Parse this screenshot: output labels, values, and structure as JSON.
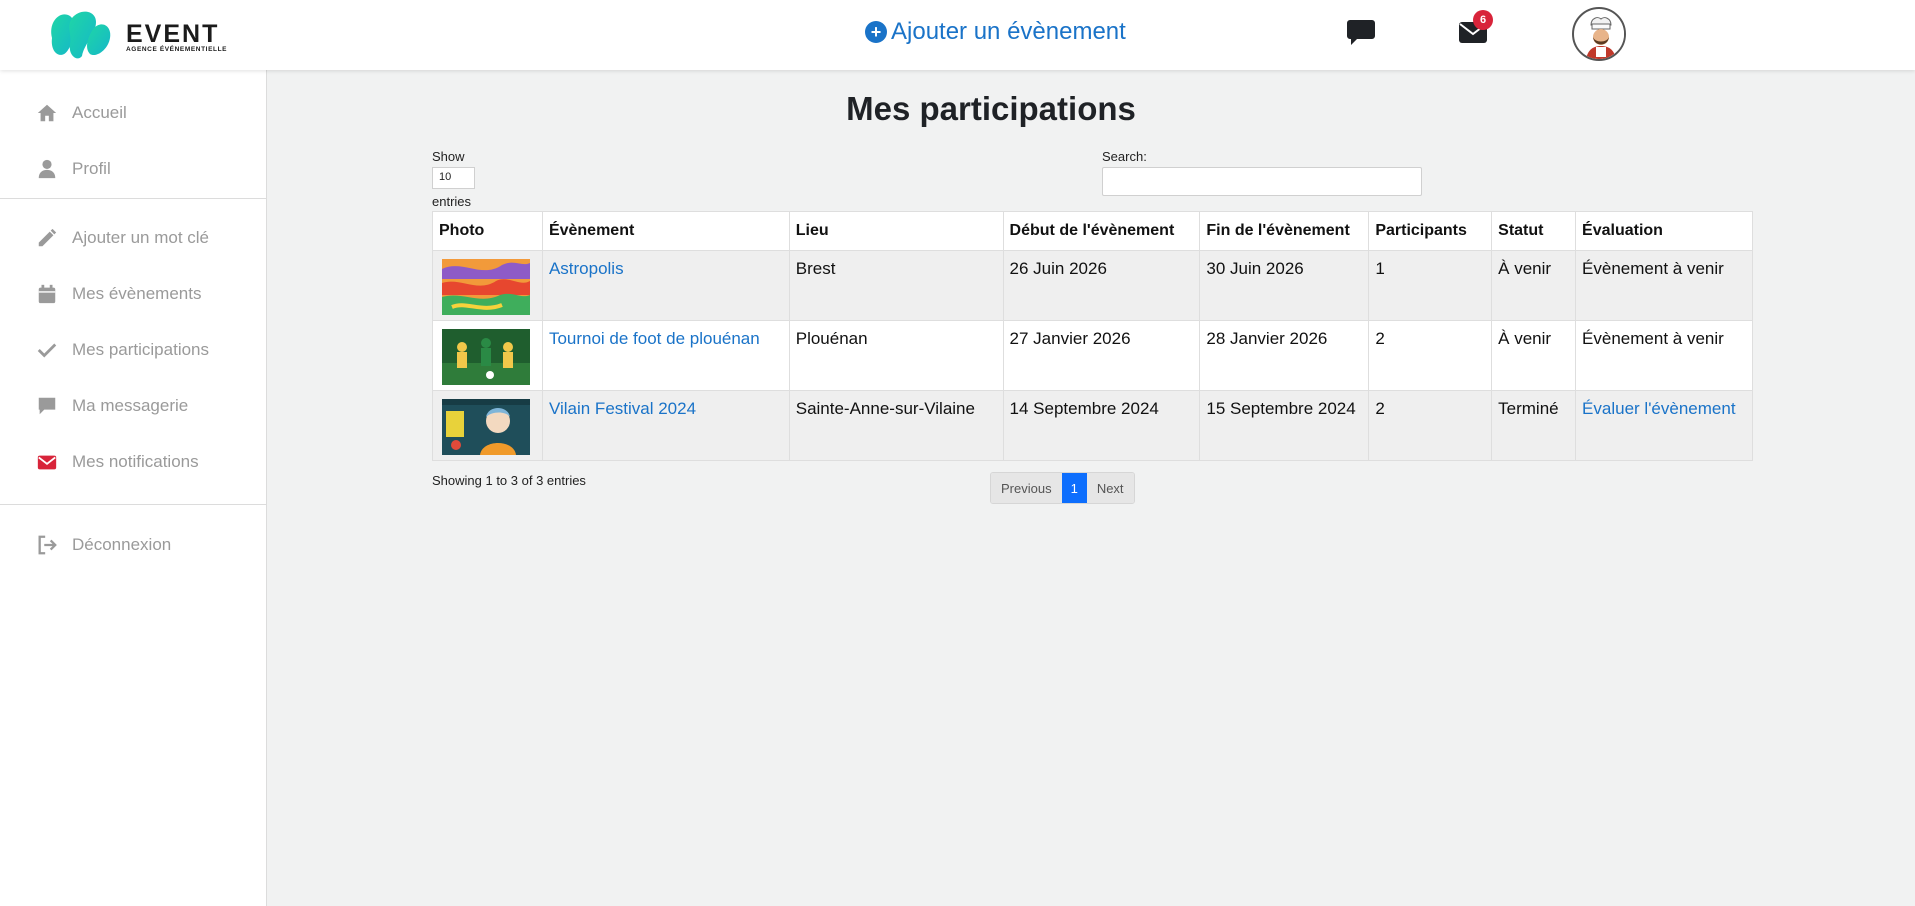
{
  "header": {
    "logo_title": "EVENT",
    "logo_subtitle": "AGENCE ÉVÉNEMENTIELLE",
    "add_event_label": "Ajouter un évènement",
    "mail_badge_count": "6",
    "accent_color": "#1a73c8",
    "badge_color": "#d8243a"
  },
  "sidebar": {
    "items": [
      {
        "label": "Accueil",
        "icon": "home-icon"
      },
      {
        "label": "Profil",
        "icon": "user-icon"
      },
      {
        "label": "Ajouter un mot clé",
        "icon": "pencil-icon"
      },
      {
        "label": "Mes évènements",
        "icon": "calendar-icon"
      },
      {
        "label": "Mes participations",
        "icon": "check-icon"
      },
      {
        "label": "Ma messagerie",
        "icon": "chat-icon"
      },
      {
        "label": "Mes notifications",
        "icon": "envelope-icon"
      },
      {
        "label": "Déconnexion",
        "icon": "logout-icon"
      }
    ]
  },
  "main": {
    "title": "Mes participations",
    "length": {
      "show_label": "Show",
      "value": "10",
      "entries_label": "entries"
    },
    "search": {
      "label": "Search:",
      "value": ""
    },
    "table": {
      "columns": [
        "Photo",
        "Évènement",
        "Lieu",
        "Début de l'évènement",
        "Fin de l'évènement",
        "Participants",
        "Statut",
        "Évaluation"
      ],
      "rows": [
        {
          "event": "Astropolis",
          "lieu": "Brest",
          "debut": "26 Juin 2026",
          "fin": "30 Juin 2026",
          "participants": "1",
          "statut": "À venir",
          "evaluation": "Évènement à venir"
        },
        {
          "event": "Tournoi de foot de plouénan",
          "lieu": "Plouénan",
          "debut": "27 Janvier 2026",
          "fin": "28 Janvier 2026",
          "participants": "2",
          "statut": "À venir",
          "evaluation": "Évènement à venir"
        },
        {
          "event": "Vilain Festival 2024",
          "lieu": "Sainte-Anne-sur-Vilaine",
          "debut": "14 Septembre 2024",
          "fin": "15 Septembre 2024",
          "participants": "2",
          "statut": "Terminé",
          "evaluation": "Évaluer l'évènement"
        }
      ]
    },
    "info": "Showing 1 to 3 of 3 entries",
    "pagination": {
      "previous": "Previous",
      "current": "1",
      "next": "Next"
    }
  }
}
